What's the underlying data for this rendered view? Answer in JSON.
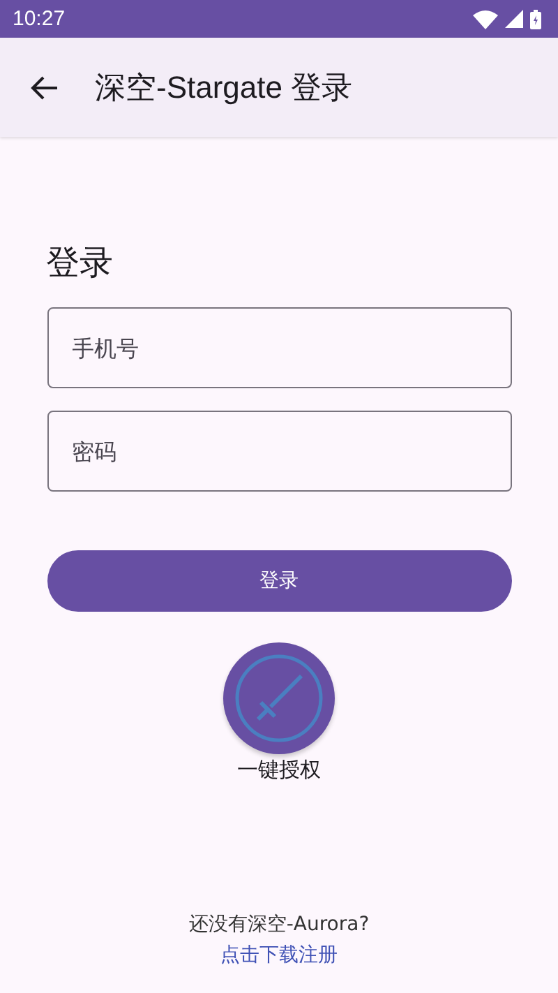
{
  "status_bar": {
    "time": "10:27"
  },
  "app_bar": {
    "title": "深空-Stargate 登录"
  },
  "heading": "登录",
  "fields": [
    {
      "placeholder": "手机号"
    },
    {
      "placeholder": "密码"
    }
  ],
  "login_button": "登录",
  "quick_auth": {
    "label": "一键授权"
  },
  "footer": {
    "prompt": "还没有深空-Aurora?",
    "link": "点击下载注册"
  }
}
